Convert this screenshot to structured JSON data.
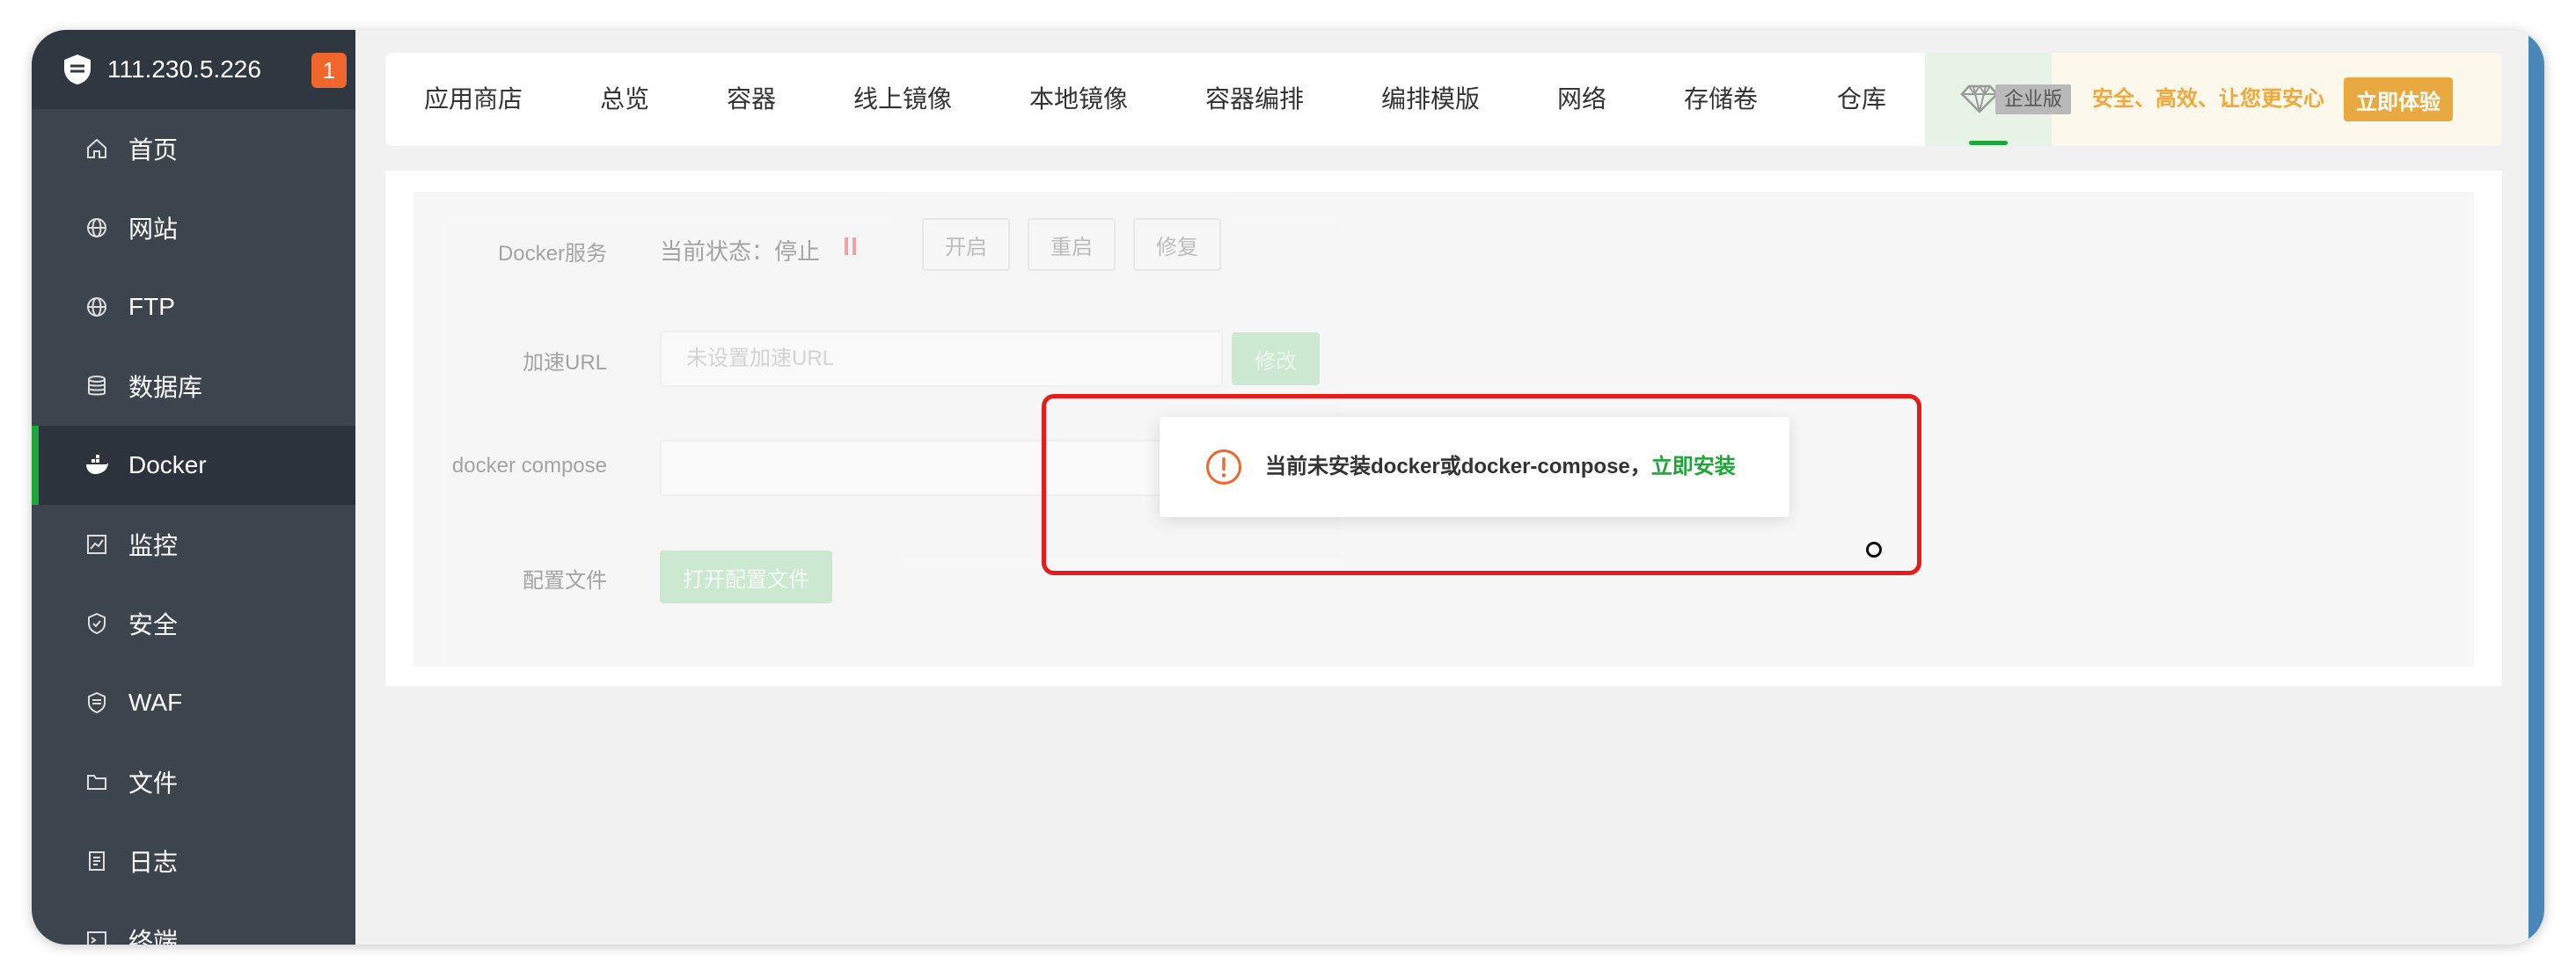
{
  "sidebar": {
    "server_ip": "111.230.5.226",
    "notification_count": "1",
    "items": [
      {
        "label": "首页",
        "icon": "home-icon"
      },
      {
        "label": "网站",
        "icon": "globe-icon"
      },
      {
        "label": "FTP",
        "icon": "ftp-globe-icon"
      },
      {
        "label": "数据库",
        "icon": "database-icon"
      },
      {
        "label": "Docker",
        "icon": "docker-whale-icon",
        "active": true
      },
      {
        "label": "监控",
        "icon": "monitor-chart-icon"
      },
      {
        "label": "安全",
        "icon": "shield-icon"
      },
      {
        "label": "WAF",
        "icon": "waf-shield-icon"
      },
      {
        "label": "文件",
        "icon": "folder-icon"
      },
      {
        "label": "日志",
        "icon": "log-document-icon"
      },
      {
        "label": "终端",
        "icon": "terminal-icon"
      }
    ]
  },
  "tabs": [
    "应用商店",
    "总览",
    "容器",
    "线上镜像",
    "本地镜像",
    "容器编排",
    "编排模版",
    "网络",
    "存储卷",
    "仓库"
  ],
  "enterprise": {
    "label": "企业版",
    "slogan": "安全、高效、让您更安心",
    "button": "立即体验"
  },
  "docker_service": {
    "label": "Docker服务",
    "status": "当前状态：停止",
    "buttons": [
      "开启",
      "重启",
      "修复"
    ]
  },
  "accel_url": {
    "label": "加速URL",
    "placeholder": "未设置加速URL",
    "button": "修改"
  },
  "compose": {
    "label": "docker compose",
    "value": ""
  },
  "config": {
    "label": "配置文件",
    "button": "打开配置文件"
  },
  "dialog": {
    "message": "当前未安装docker或docker-compose，",
    "link": "立即安装"
  },
  "colors": {
    "accent_green": "#20a53a",
    "sidebar_bg": "#3c444d",
    "warning_orange": "#f0662d",
    "enterprise_gold": "#e8a940",
    "annotation_red": "#e81b1b"
  }
}
